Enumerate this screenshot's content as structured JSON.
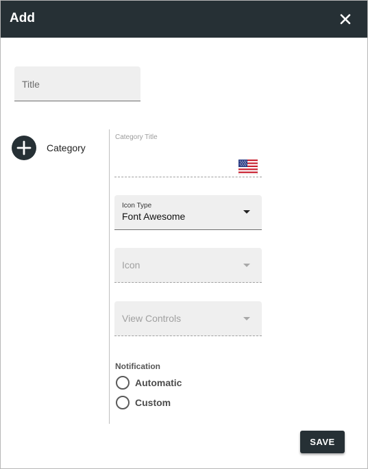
{
  "dialog": {
    "title": "Add"
  },
  "form": {
    "title_label": "Title",
    "category_label": "Category",
    "category_title_label": "Category Title",
    "flag_icon": "us-flag-icon",
    "icon_type": {
      "label": "Icon Type",
      "value": "Font Awesome"
    },
    "icon": {
      "placeholder": "Icon"
    },
    "view_controls": {
      "placeholder": "View Controls"
    },
    "notification": {
      "label": "Notification",
      "options": [
        "Automatic",
        "Custom"
      ]
    }
  },
  "actions": {
    "save_label": "SAVE"
  },
  "colors": {
    "header_bg": "#263035",
    "field_bg": "#efefef"
  }
}
